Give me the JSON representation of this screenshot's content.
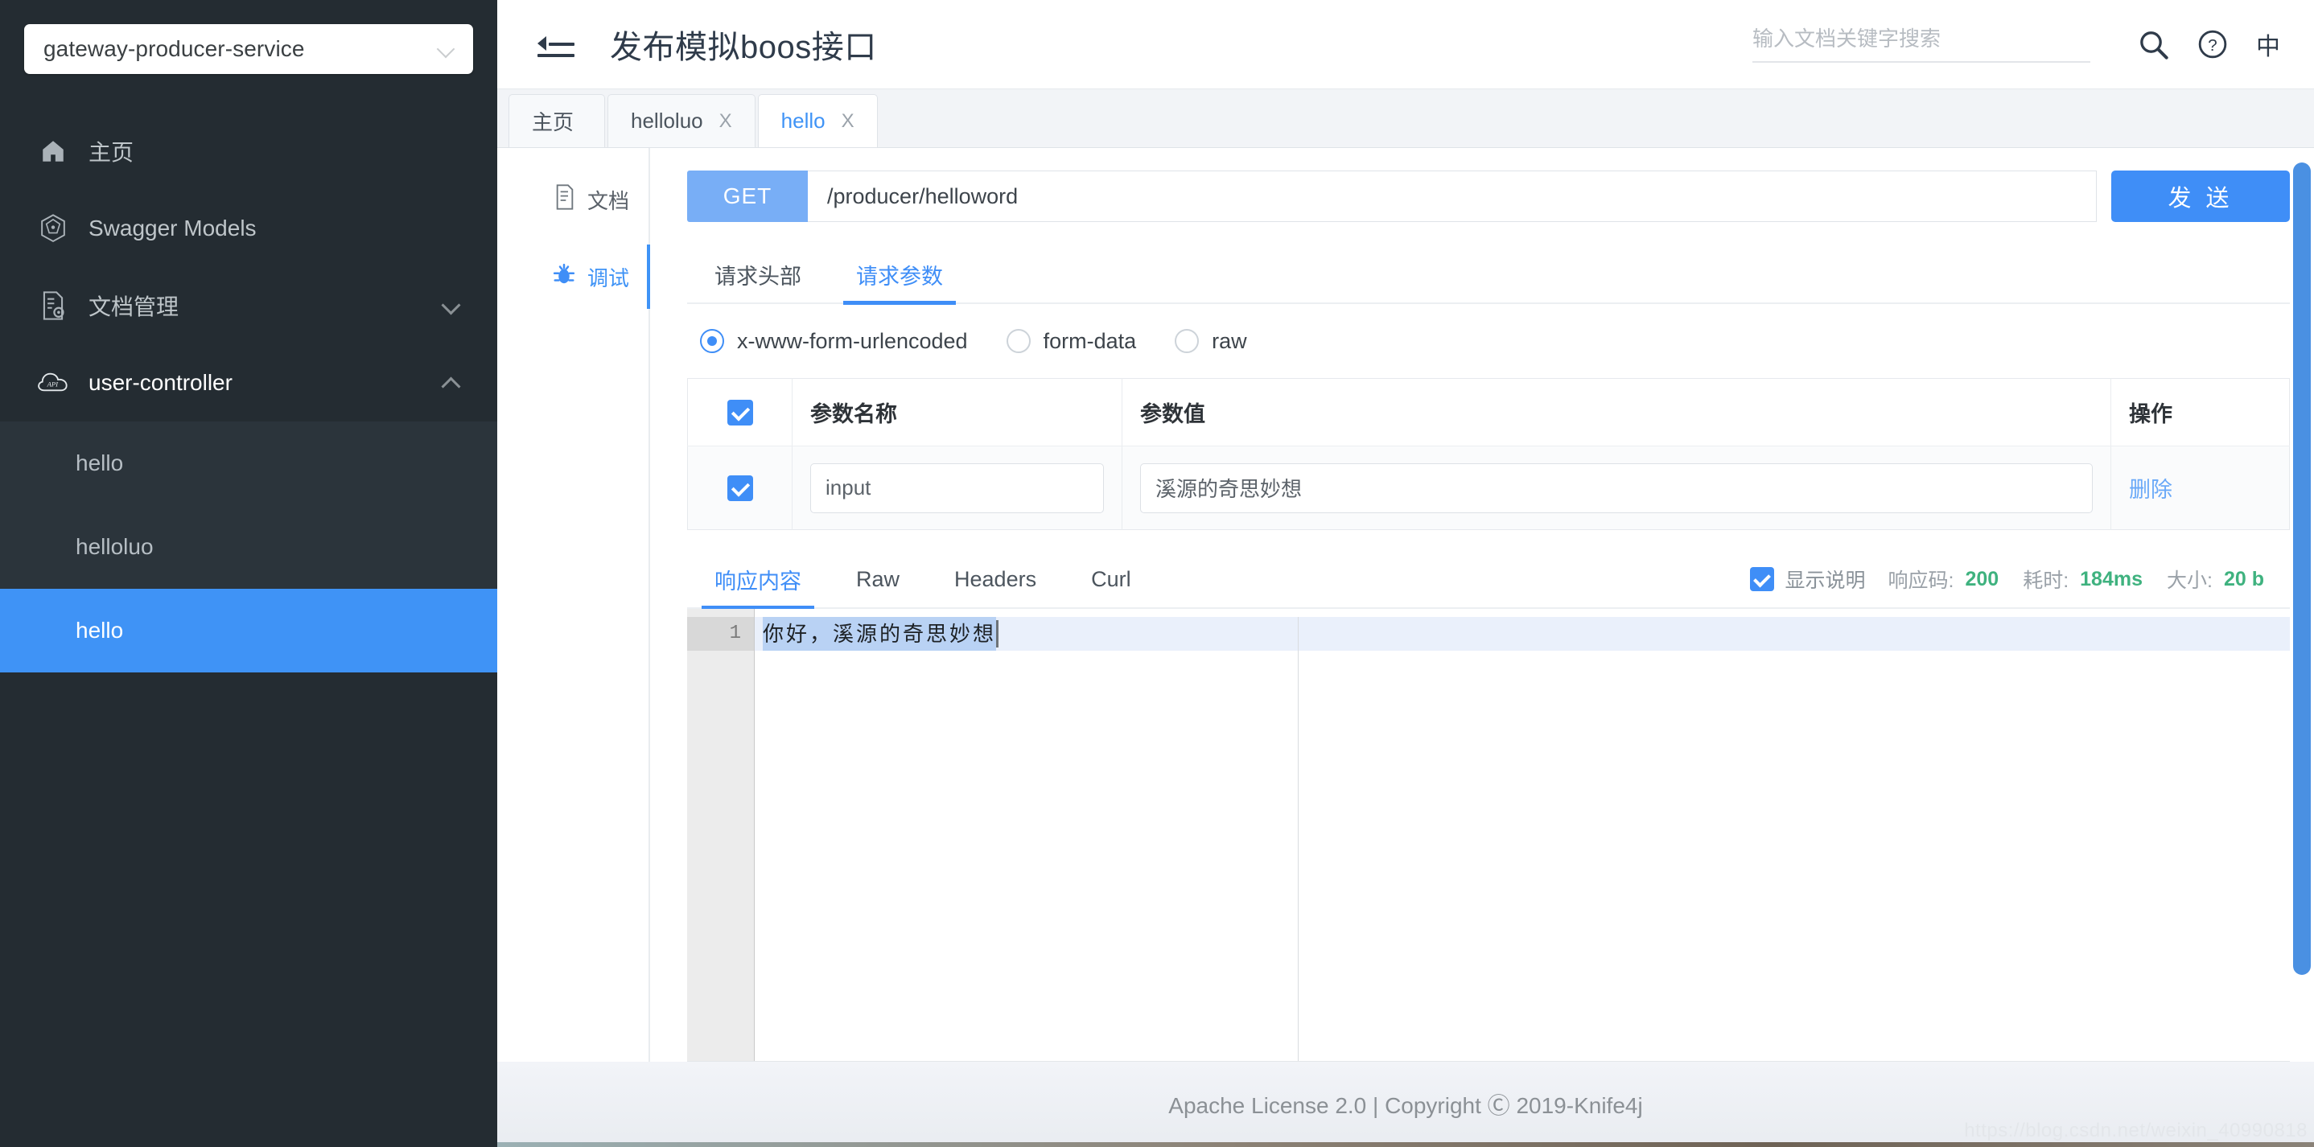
{
  "sidebar": {
    "service_selector": {
      "value": "gateway-producer-service",
      "icon": "chevron-down-icon"
    },
    "items": [
      {
        "label": "主页",
        "icon": "home-icon",
        "type": "link"
      },
      {
        "label": "Swagger Models",
        "icon": "swagger-models-icon",
        "type": "link"
      },
      {
        "label": "文档管理",
        "icon": "document-settings-icon",
        "type": "group",
        "expanded": false,
        "caret": "chevron-down-icon"
      },
      {
        "label": "user-controller",
        "icon": "api-cloud-icon",
        "type": "group",
        "expanded": true,
        "caret": "chevron-up-icon"
      }
    ],
    "sub_items": [
      {
        "label": "hello",
        "active": false
      },
      {
        "label": "helloluo",
        "active": false
      },
      {
        "label": "hello",
        "active": true
      }
    ]
  },
  "header": {
    "menu_toggle_icon": "collapse-menu-icon",
    "title": "发布模拟boos接口",
    "search": {
      "placeholder": "输入文档关键字搜索",
      "value": ""
    },
    "search_icon": "search-icon",
    "help_icon": "question-circle-icon",
    "language_label": "中"
  },
  "tabs": [
    {
      "label": "主页",
      "closable": false,
      "active": false
    },
    {
      "label": "helloluo",
      "closable": true,
      "active": false,
      "close_label": "X"
    },
    {
      "label": "hello",
      "closable": true,
      "active": true,
      "close_label": "X"
    }
  ],
  "mode_nav": [
    {
      "label": "文档",
      "icon": "document-icon",
      "active": false
    },
    {
      "label": "调试",
      "icon": "bug-icon",
      "active": true
    }
  ],
  "request": {
    "method": "GET",
    "url": "/producer/helloword",
    "url_placeholder": "",
    "send_label": "发 送",
    "tabs": [
      {
        "label": "请求头部",
        "active": false
      },
      {
        "label": "请求参数",
        "active": true
      }
    ],
    "body_types": [
      {
        "label": "x-www-form-urlencoded",
        "selected": true
      },
      {
        "label": "form-data",
        "selected": false
      },
      {
        "label": "raw",
        "selected": false
      }
    ],
    "table": {
      "headers": [
        "",
        "参数名称",
        "参数值",
        "操作"
      ],
      "header_checkbox_checked": true,
      "rows": [
        {
          "checked": true,
          "name": "input",
          "value": "溪源的奇思妙想",
          "action_label": "删除"
        }
      ]
    }
  },
  "response": {
    "tabs": [
      {
        "label": "响应内容",
        "active": true
      },
      {
        "label": "Raw",
        "active": false
      },
      {
        "label": "Headers",
        "active": false
      },
      {
        "label": "Curl",
        "active": false
      }
    ],
    "show_desc": {
      "label": "显示说明",
      "checked": true
    },
    "status": {
      "code_key": "响应码:",
      "code_value": "200",
      "time_key": "耗时:",
      "time_value": "184ms",
      "size_key": "大小:",
      "size_value": "20 b"
    },
    "body_lines": [
      {
        "number": "1",
        "text": "你好，溪源的奇思妙想"
      }
    ]
  },
  "footer": {
    "text": "Apache License 2.0 | Copyright Ⓒ 2019-Knife4j",
    "watermark": "https://blog.csdn.net/weixin_40990818"
  },
  "colors": {
    "accent": "#3f8ef7",
    "sidebar_bg": "#242c32",
    "success": "#3fb27f"
  }
}
